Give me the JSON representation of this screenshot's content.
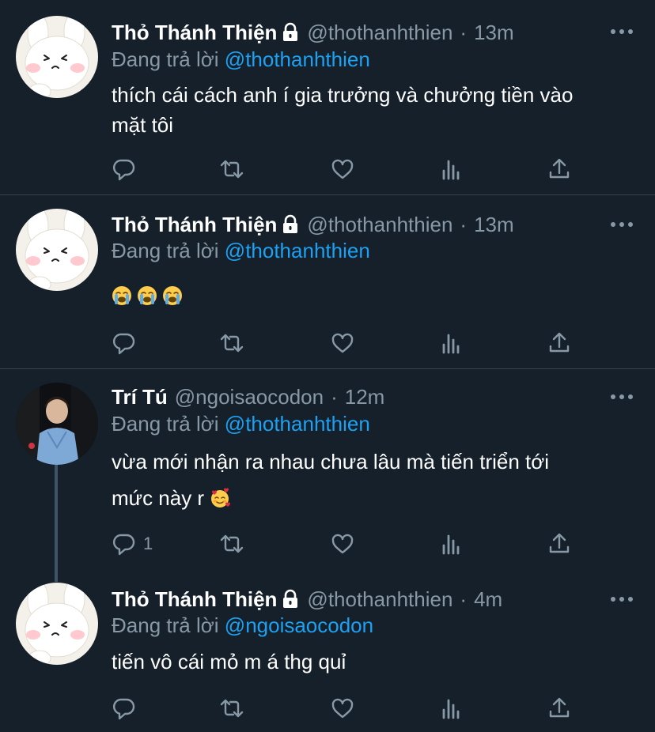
{
  "colors": {
    "background": "#15202b",
    "divider": "#38444d",
    "muted": "#8899a6",
    "link": "#1da1f2",
    "text": "#ffffff"
  },
  "tweets": [
    {
      "name": "Thỏ Thánh Thiện",
      "protected": true,
      "handle": "@thothanhthien",
      "dot": "·",
      "time": "13m",
      "reply_prefix": "Đang trả lời",
      "reply_to": "@thothanhthien",
      "text_lines": [
        "thích cái cách anh í gia trưởng và chưởng tiền vào",
        "mặt tôi"
      ],
      "reply_count": ""
    },
    {
      "name": "Thỏ Thánh Thiện",
      "protected": true,
      "handle": "@thothanhthien",
      "dot": "·",
      "time": "13m",
      "reply_prefix": "Đang trả lời",
      "reply_to": "@thothanhthien",
      "emojis": [
        "loudly-crying-face",
        "loudly-crying-face",
        "loudly-crying-face"
      ],
      "reply_count": ""
    },
    {
      "name": "Trí Tú",
      "protected": false,
      "handle": "@ngoisaocodon",
      "dot": "·",
      "time": "12m",
      "reply_prefix": "Đang trả lời",
      "reply_to": "@thothanhthien",
      "text_lines": [
        "vừa mới nhận ra nhau chưa lâu mà tiến triển tới",
        "mức này r"
      ],
      "trailing_emoji": "smiling-face-with-hearts",
      "reply_count": "1"
    },
    {
      "name": "Thỏ Thánh Thiện",
      "protected": true,
      "handle": "@thothanhthien",
      "dot": "·",
      "time": "4m",
      "reply_prefix": "Đang trả lời",
      "reply_to": "@ngoisaocodon",
      "text_lines": [
        "tiến vô cái mỏ m á thg quỉ"
      ],
      "reply_count": ""
    }
  ],
  "action_icons": [
    "reply-icon",
    "retweet-icon",
    "like-icon",
    "analytics-icon",
    "share-icon"
  ]
}
